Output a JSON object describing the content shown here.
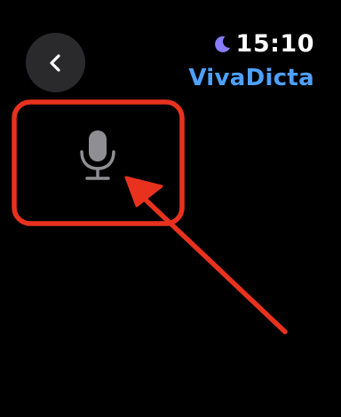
{
  "status_bar": {
    "time": "15:10",
    "app_title": "VivaDicta",
    "focus_icon": "moon-icon"
  },
  "navigation": {
    "back_icon": "chevron-left-icon"
  },
  "main": {
    "dictation_icon": "microphone-icon"
  },
  "colors": {
    "background": "#000000",
    "app_title": "#4ea1ff",
    "moon": "#8a7cff",
    "back_button_bg": "#2a2a2c",
    "microphone": "#8e8e93",
    "annotation": "#e8321e"
  }
}
